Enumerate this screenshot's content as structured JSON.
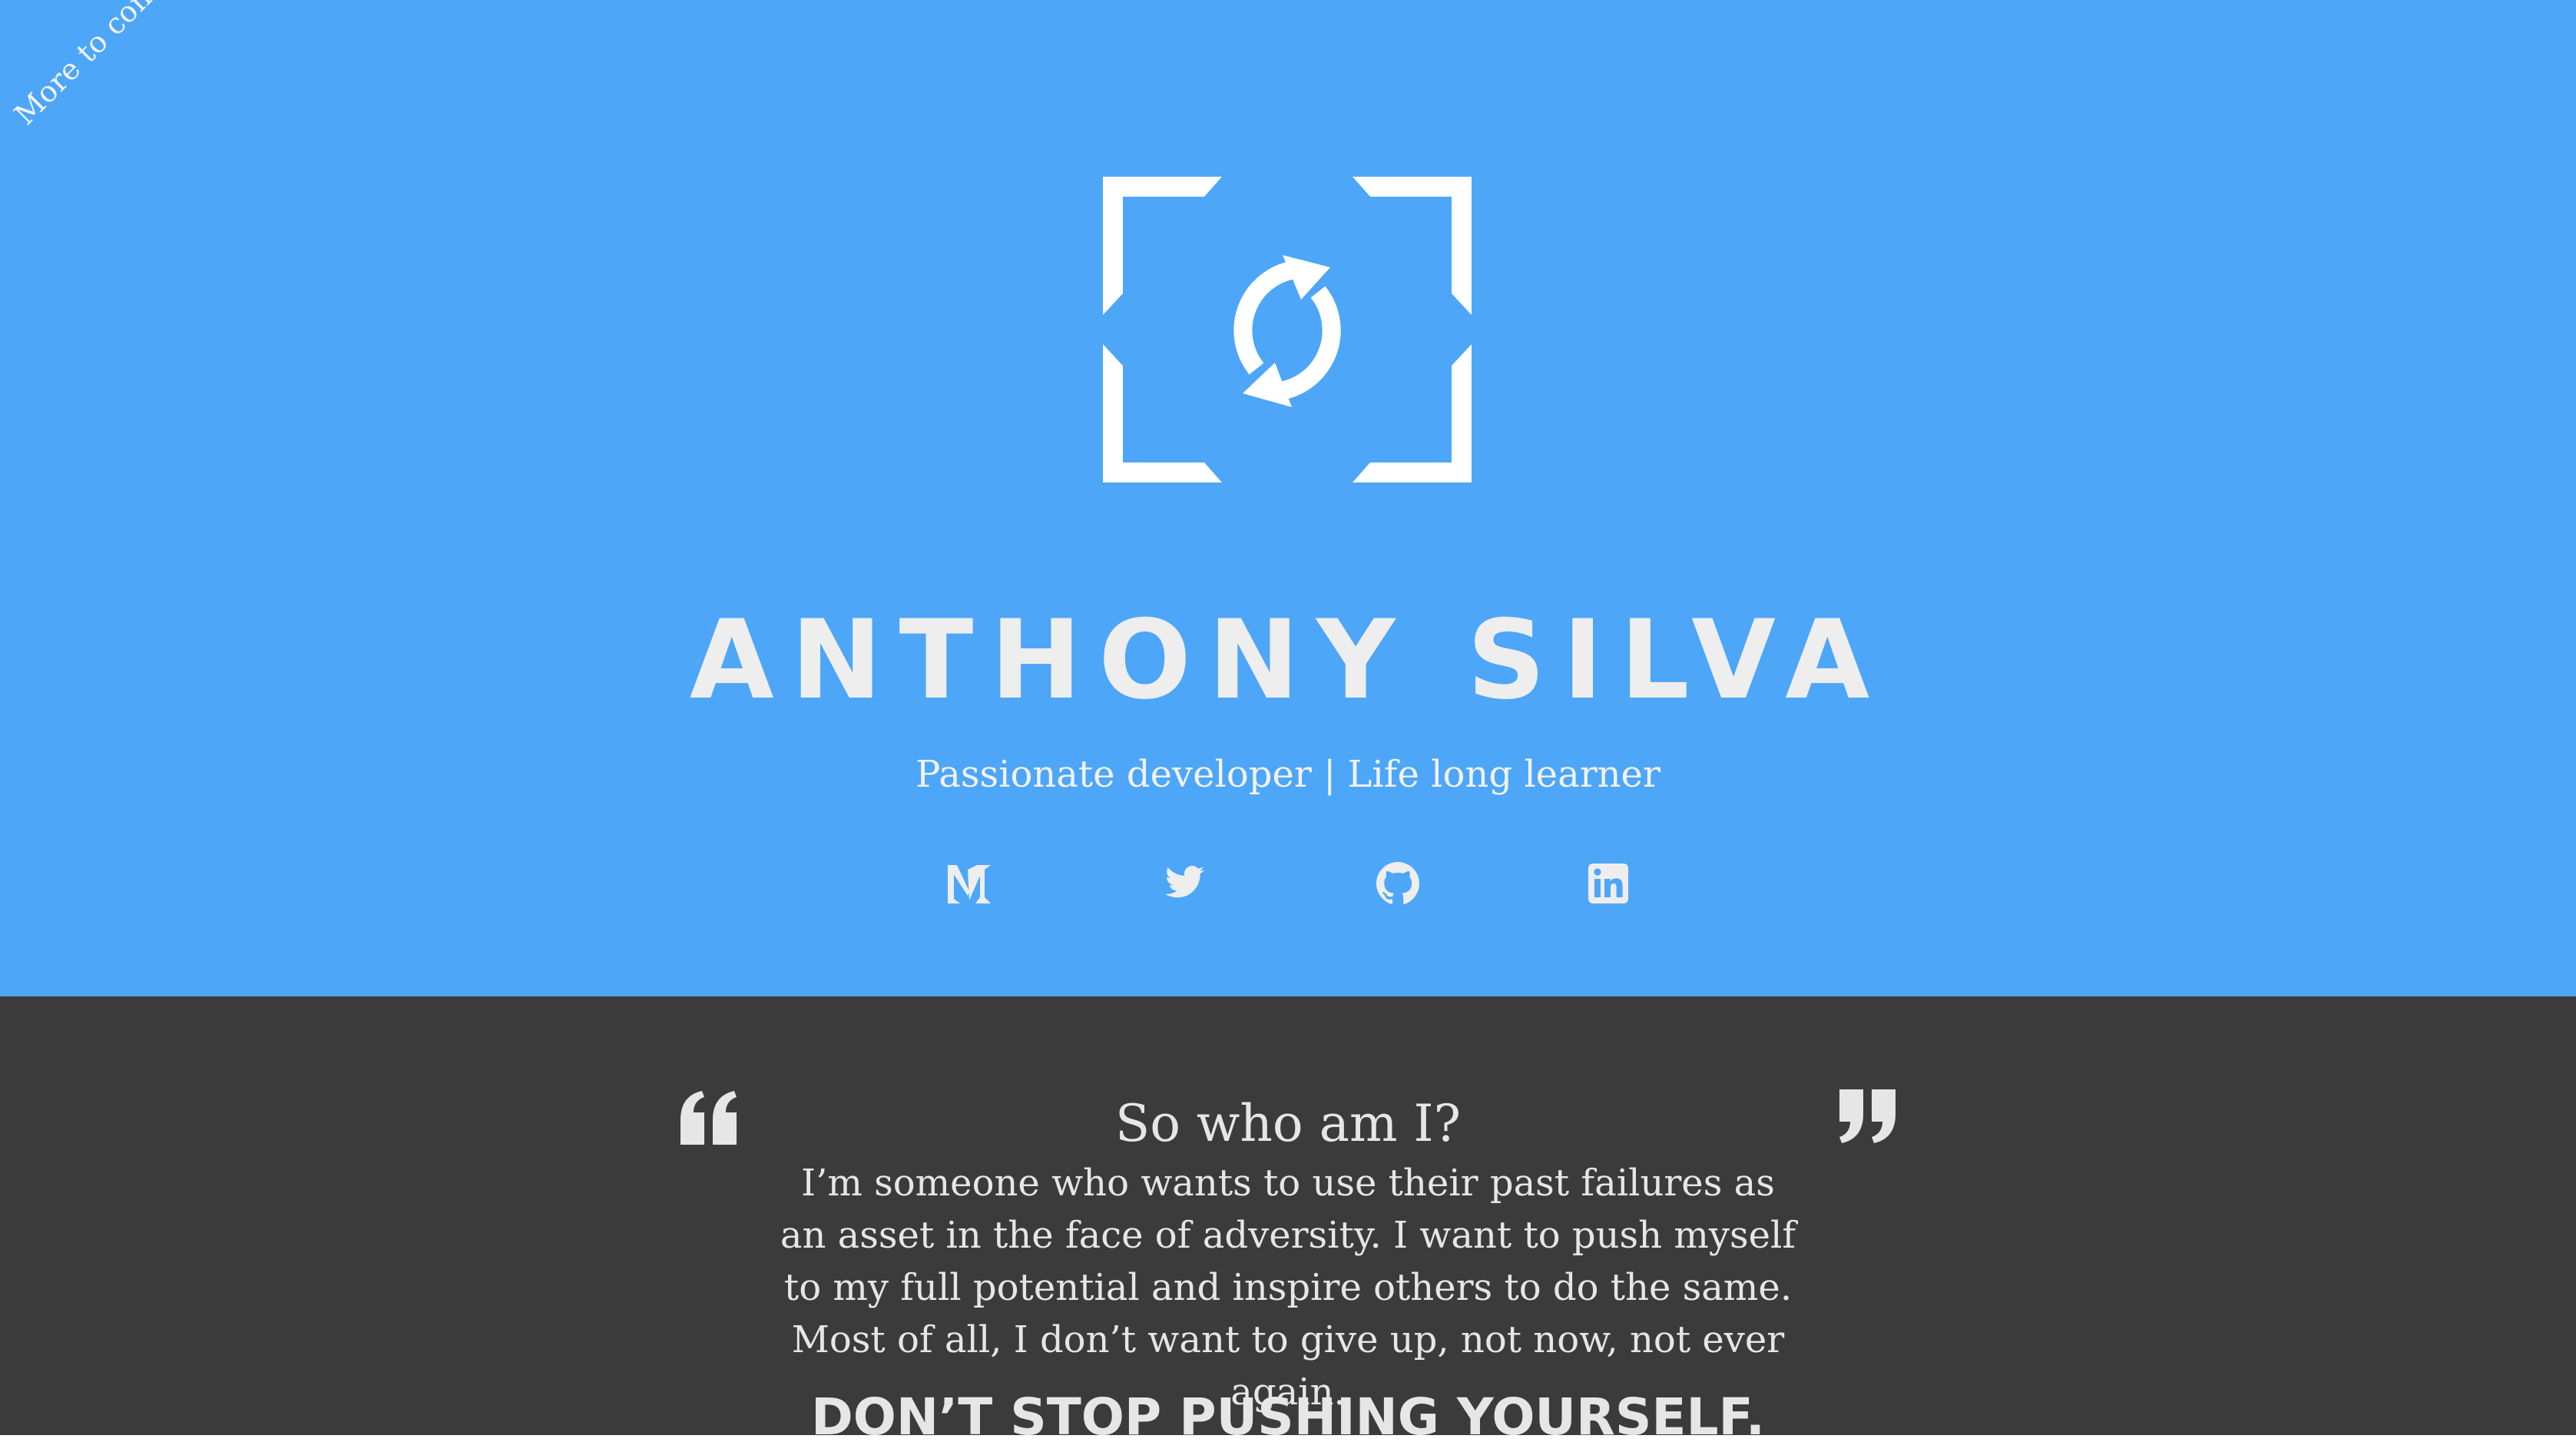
{
  "banner": {
    "text": "More to come soon!"
  },
  "hero": {
    "name": "ANTHONY SILVA",
    "tagline": "Passionate developer | Life long learner",
    "logo_icon": "refresh-frame-icon",
    "background_color": "#4da6f8",
    "text_color": "#eeeeee"
  },
  "social": [
    {
      "icon": "medium-icon"
    },
    {
      "icon": "twitter-icon"
    },
    {
      "icon": "github-icon"
    },
    {
      "icon": "linkedin-icon"
    }
  ],
  "about": {
    "title": "So who am I?",
    "body": "I’m someone who wants to use their past failures as an asset in the face of adversity. I want to push myself to my full potential and inspire others to do the same. Most of all, I don’t want to give up, not now, not ever again.",
    "motto": "DON’T STOP PUSHING YOURSELF.",
    "background_color": "#3b3b3b",
    "open_quote_icon": "open-quote-icon",
    "close_quote_icon": "close-quote-icon"
  }
}
